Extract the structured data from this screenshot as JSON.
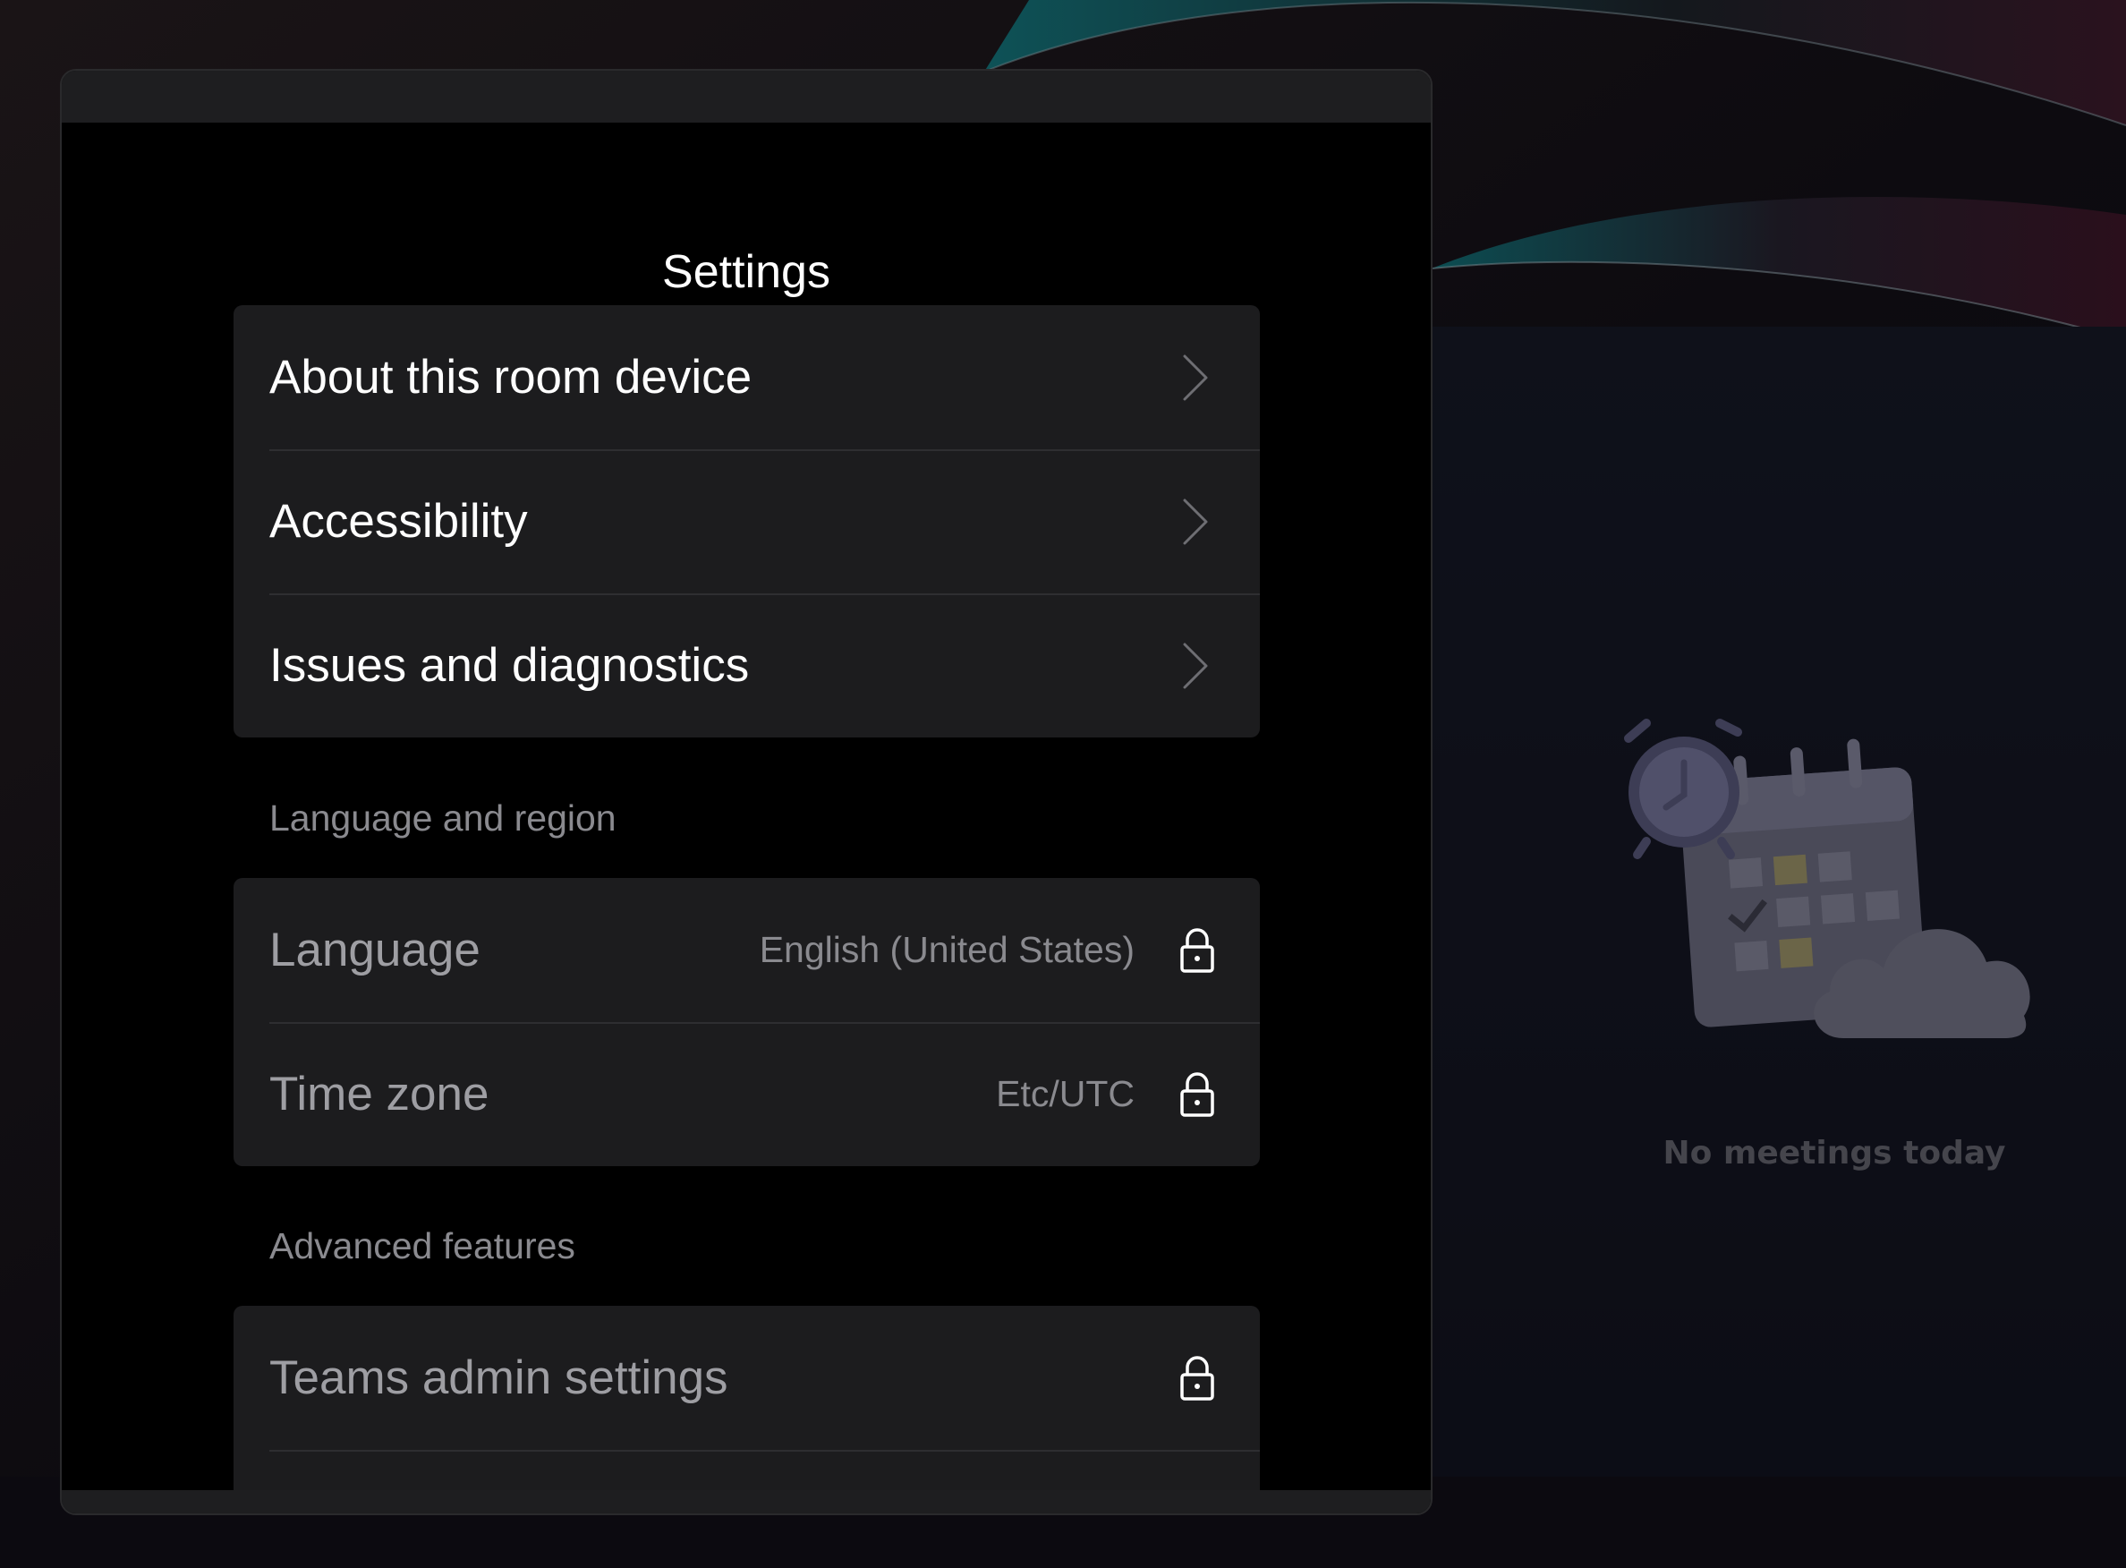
{
  "settings": {
    "title": "Settings",
    "general_items": [
      {
        "label": "About this room device",
        "icon": "chevron-right-icon"
      },
      {
        "label": "Accessibility",
        "icon": "chevron-right-icon"
      },
      {
        "label": "Issues and diagnostics",
        "icon": "chevron-right-icon"
      }
    ],
    "language_region": {
      "header": "Language and region",
      "items": [
        {
          "label": "Language",
          "value": "English (United States)",
          "icon": "lock-icon"
        },
        {
          "label": "Time zone",
          "value": "Etc/UTC",
          "icon": "lock-icon"
        }
      ]
    },
    "advanced": {
      "header": "Advanced features",
      "items": [
        {
          "label": "Teams admin settings",
          "icon": "lock-icon"
        }
      ]
    }
  },
  "calendar": {
    "empty_message": "No meetings today",
    "illustration": "calendar-clock-cloud-illustration"
  },
  "colors": {
    "panel_background": "#000000",
    "row_background": "#1c1c1e",
    "accent_teal": "#0f5a5f"
  }
}
